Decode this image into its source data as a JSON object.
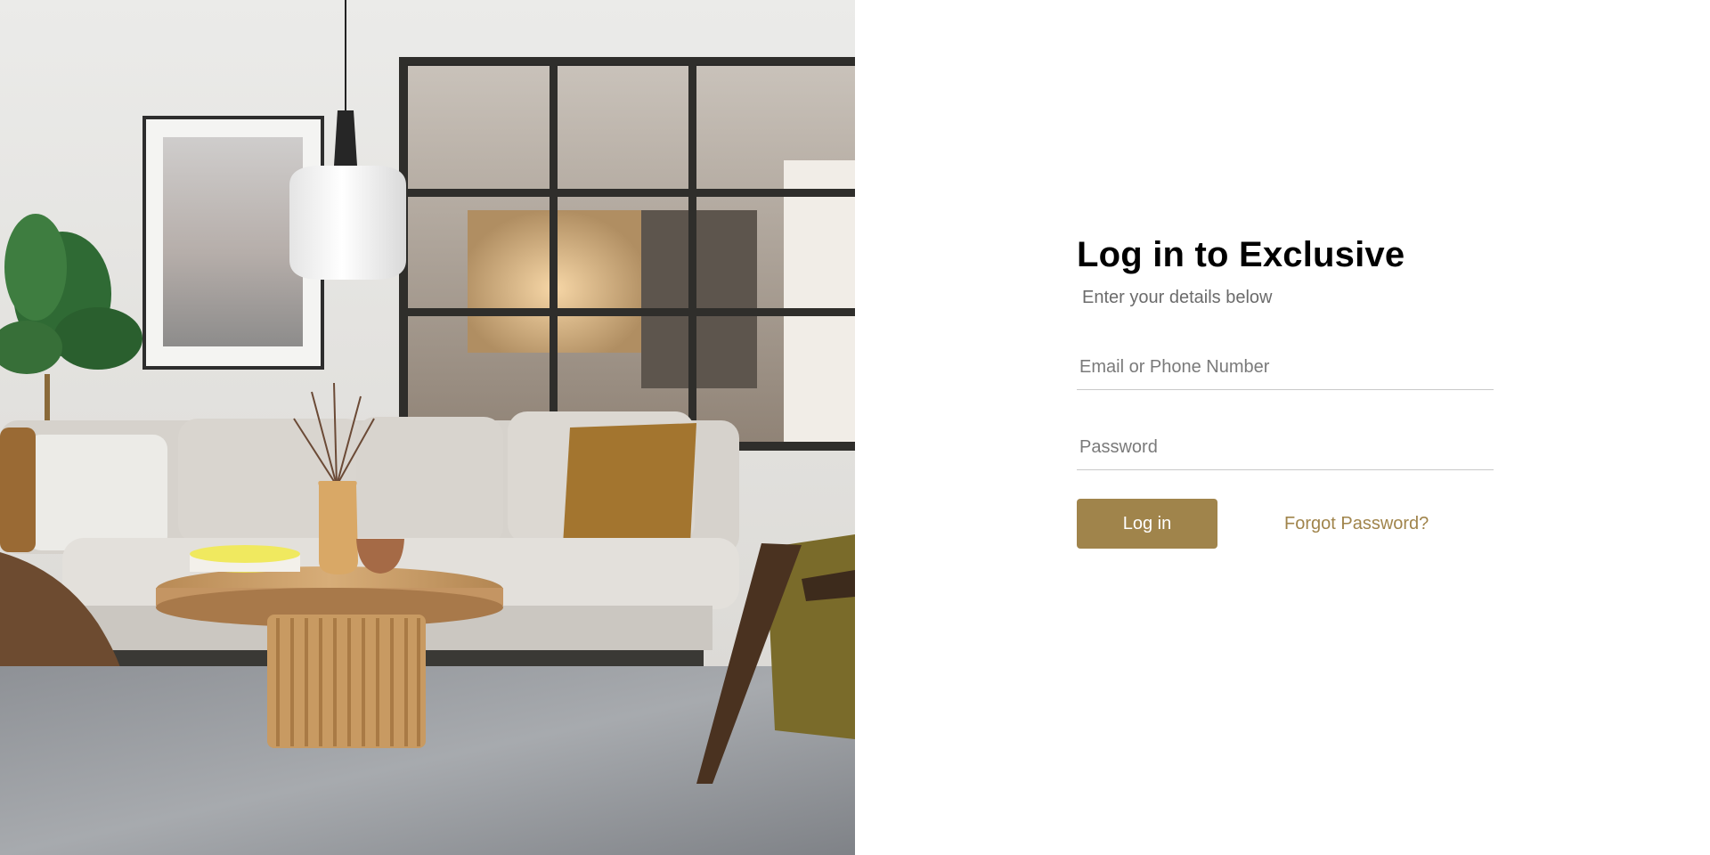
{
  "hero": {
    "image_name": "living-room-interior-photo"
  },
  "login": {
    "title": "Log in to Exclusive",
    "subtitle": "Enter your details below",
    "email_placeholder": "Email or Phone Number",
    "password_placeholder": "Password",
    "email_value": "",
    "password_value": "",
    "login_label": "Log in",
    "forgot_label": "Forgot Password?"
  },
  "colors": {
    "accent": "#a0844b",
    "subtitle_text": "#6b6b6b",
    "divider": "#c9c9c9"
  }
}
